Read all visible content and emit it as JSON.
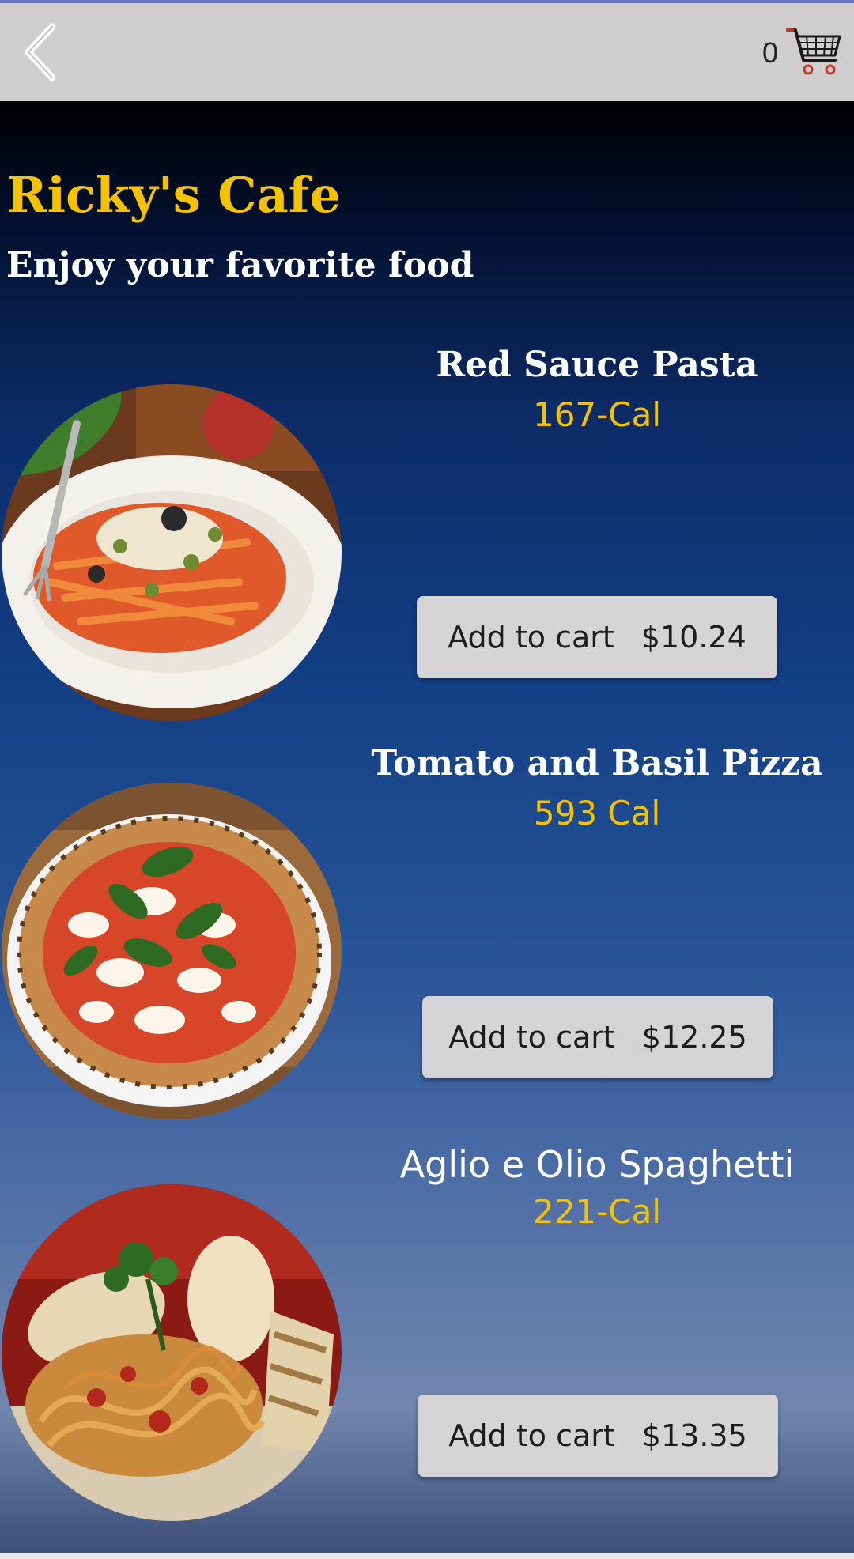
{
  "header": {
    "back_icon": "chevron-left-icon",
    "cart_count": "0",
    "cart_icon": "shopping-cart-icon"
  },
  "restaurant": {
    "name": "Ricky's Cafe",
    "tagline": "Enjoy your favorite food"
  },
  "menu": [
    {
      "name": "Red Sauce Pasta",
      "calories": "167-Cal",
      "button_label": "Add to cart",
      "price": "$10.24"
    },
    {
      "name": "Tomato and Basil Pizza",
      "calories": "593 Cal",
      "button_label": "Add to cart",
      "price": "$12.25"
    },
    {
      "name": "Aglio e Olio Spaghetti",
      "calories": "221-Cal",
      "button_label": "Add to cart",
      "price": "$13.35"
    }
  ],
  "colors": {
    "accent_yellow": "#f5c200",
    "header_bg": "#cfcdce",
    "button_bg": "#d4d4d6",
    "title_white": "#ffffff"
  }
}
